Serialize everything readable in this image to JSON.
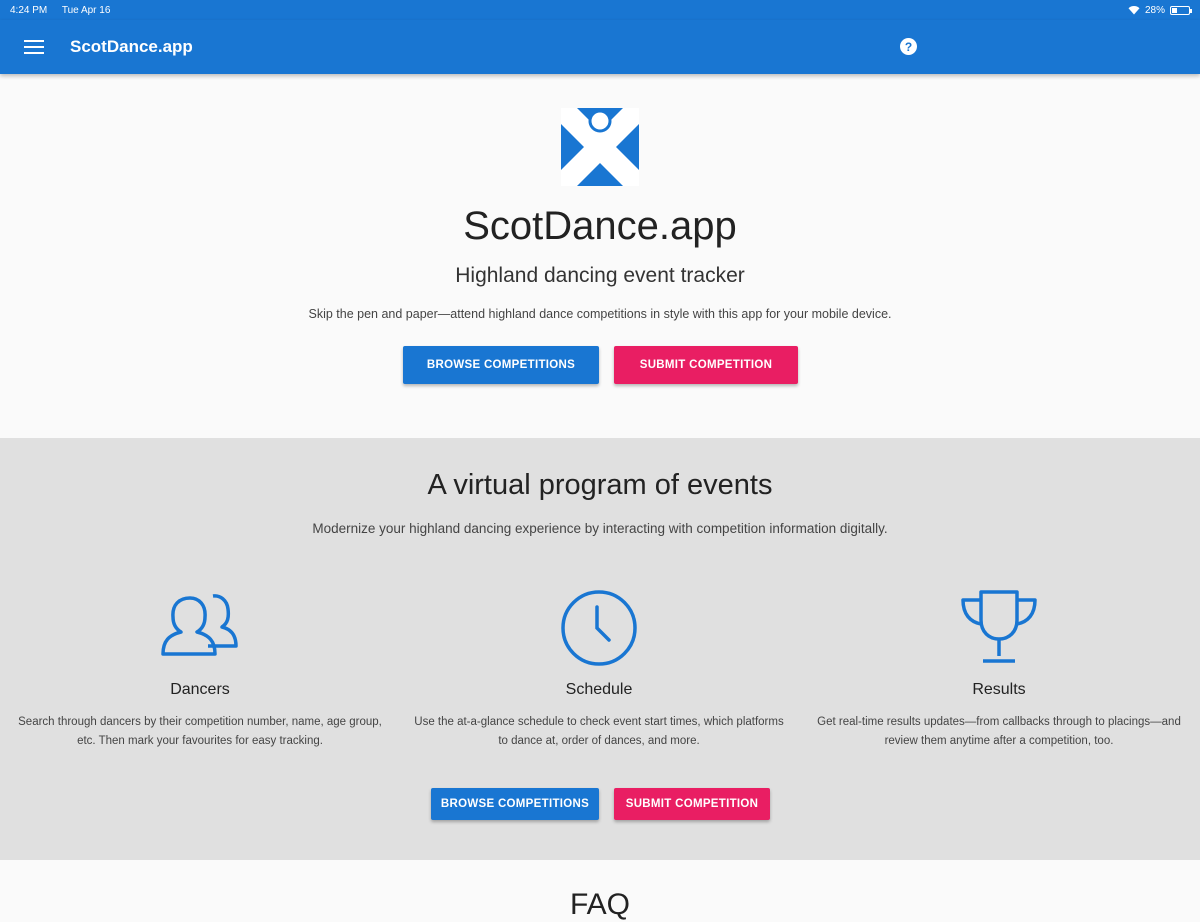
{
  "status_bar": {
    "time": "4:24 PM",
    "date": "Tue Apr 16",
    "battery": "28%",
    "battery_level": 0.28
  },
  "app_bar": {
    "menu_icon": "menu-icon",
    "title": "ScotDance.app",
    "help_icon": "help-icon",
    "help_glyph": "?"
  },
  "hero": {
    "logo_icon": "saltire-dancer-logo",
    "title": "ScotDance.app",
    "subtitle": "Highland dancing event tracker",
    "description": "Skip the pen and paper—attend highland dance competitions in style with this app for your mobile device.",
    "browse_label": "Browse Competitions",
    "submit_label": "Submit Competition"
  },
  "features": {
    "title": "A virtual program of events",
    "description": "Modernize your highland dancing experience by interacting with competition information digitally.",
    "items": [
      {
        "icon": "people-icon",
        "name": "Dancers",
        "text": "Search through dancers by their competition number, name, age group, etc. Then mark your favourites for easy tracking."
      },
      {
        "icon": "clock-icon",
        "name": "Schedule",
        "text": "Use the at-a-glance schedule to check event start times, which platforms to dance at, order of dances, and more."
      },
      {
        "icon": "trophy-icon",
        "name": "Results",
        "text": "Get real-time results updates—from callbacks through to placings—and review them anytime after a competition, too."
      }
    ],
    "browse_label": "Browse Competitions",
    "submit_label": "Submit Competition"
  },
  "faq": {
    "title": "FAQ"
  },
  "colors": {
    "primary": "#1976d2",
    "accent": "#e91e63",
    "section_bg": "#e0e0e0"
  }
}
